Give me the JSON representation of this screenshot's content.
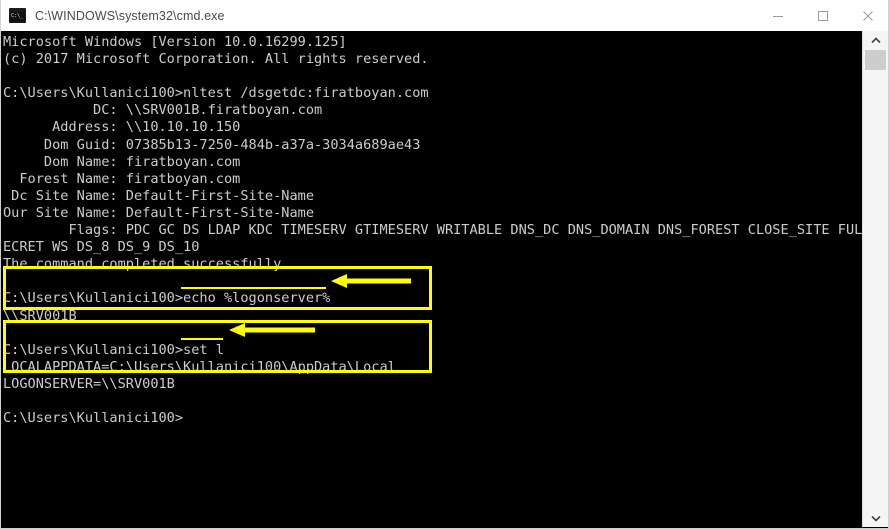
{
  "window": {
    "title": "C:\\WINDOWS\\system32\\cmd.exe",
    "icon": "cmd-icon",
    "icon_glyph": "C:\\_",
    "controls": {
      "minimize_label": "Minimize",
      "maximize_label": "Maximize",
      "close_label": "Close"
    }
  },
  "colors": {
    "titlebar_bg": "#ffffff",
    "title_text": "#4a4a4a",
    "console_bg": "#000000",
    "console_text": "#cccccc",
    "annotation": "#ffff00",
    "scrollbar_track": "#f5f5f5",
    "scrollbar_thumb": "#cdcdcd"
  },
  "console": {
    "prompt": "C:\\Users\\Kullanici100>",
    "lines": [
      "Microsoft Windows [Version 10.0.16299.125]",
      "(c) 2017 Microsoft Corporation. All rights reserved.",
      "",
      "C:\\Users\\Kullanici100>nltest /dsgetdc:firatboyan.com",
      "           DC: \\\\SRV001B.firatboyan.com",
      "      Address: \\\\10.10.10.150",
      "     Dom Guid: 07385b13-7250-484b-a37a-3034a689ae43",
      "     Dom Name: firatboyan.com",
      "  Forest Name: firatboyan.com",
      " Dc Site Name: Default-First-Site-Name",
      "Our Site Name: Default-First-Site-Name",
      "        Flags: PDC GC DS LDAP KDC TIMESERV GTIMESERV WRITABLE DNS_DC DNS_DOMAIN DNS_FOREST CLOSE_SITE FULL_S",
      "ECRET WS DS_8 DS_9 DS_10",
      "The command completed successfully",
      "",
      "C:\\Users\\Kullanici100>echo %logonserver%",
      "\\\\SRV001B",
      "",
      "C:\\Users\\Kullanici100>set l",
      "LOCALAPPDATA=C:\\Users\\Kullanici100\\AppData\\Local",
      "LOGONSERVER=\\\\SRV001B",
      "",
      "C:\\Users\\Kullanici100>"
    ]
  },
  "annotations": {
    "box1": {
      "highlighted_command": "echo %logonserver%",
      "output": "\\\\SRV001B"
    },
    "box2": {
      "highlighted_command": "set l",
      "output_1": "LOCALAPPDATA=C:\\Users\\Kullanici100\\AppData\\Local",
      "output_2": "LOGONSERVER=\\\\SRV001B"
    },
    "arrow1": "left-arrow-icon",
    "arrow2": "left-arrow-icon"
  }
}
